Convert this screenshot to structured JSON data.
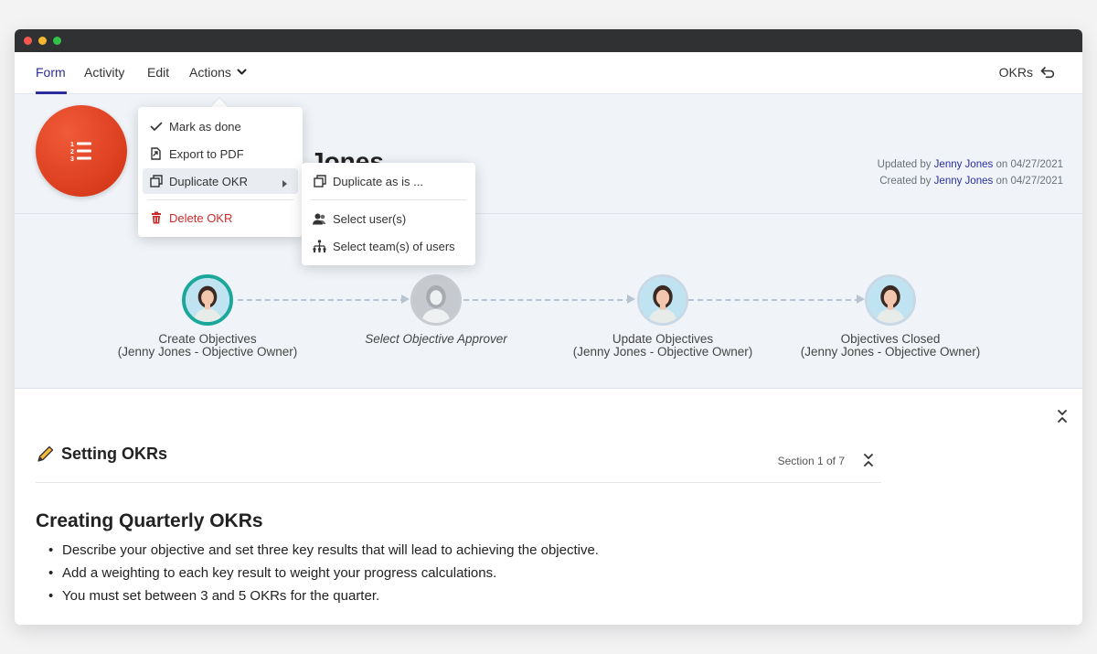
{
  "nav": {
    "tabs": [
      {
        "label": "Form",
        "active": true
      },
      {
        "label": "Activity"
      },
      {
        "label": "Edit"
      },
      {
        "label": "Actions"
      }
    ],
    "right_link": "OKRs",
    "accent_color": "#2a2d9c"
  },
  "header": {
    "title_visible_fragment": "Jones",
    "updated": {
      "prefix": "Updated by",
      "user": "Jenny Jones",
      "on": "on 04/27/2021"
    },
    "created": {
      "prefix": "Created by",
      "user": "Jenny Jones",
      "on": "on 04/27/2021"
    },
    "icon": "list-ordered-icon",
    "icon_color": "#d83b1b"
  },
  "actions_menu": {
    "items": [
      {
        "label": "Mark as done",
        "icon": "check-icon"
      },
      {
        "label": "Export to PDF",
        "icon": "export-pdf-icon"
      },
      {
        "label": "Duplicate OKR",
        "icon": "duplicate-icon",
        "highlighted": true,
        "has_submenu": true
      },
      {
        "label": "Delete OKR",
        "icon": "trash-icon",
        "danger": true
      }
    ],
    "submenu": [
      {
        "label": "Duplicate as is ...",
        "icon": "duplicate-icon"
      },
      {
        "label": "Select user(s)",
        "icon": "users-icon"
      },
      {
        "label": "Select team(s) of users",
        "icon": "team-hierarchy-icon"
      }
    ]
  },
  "workflow": {
    "steps": [
      {
        "name": "Create Objectives",
        "owner": "(Jenny Jones - Objective Owner)",
        "state": "current"
      },
      {
        "name": "Select Objective Approver",
        "owner": "",
        "state": "unassigned"
      },
      {
        "name": "Update Objectives",
        "owner": "(Jenny Jones - Objective Owner)",
        "state": "pending"
      },
      {
        "name": "Objectives Closed",
        "owner": "(Jenny Jones - Objective Owner)",
        "state": "pending"
      }
    ],
    "current_color": "#1aa89a"
  },
  "section": {
    "title": "Setting OKRs",
    "counter": "Section 1 of 7",
    "heading": "Creating Quarterly OKRs",
    "bullets": [
      "Describe your objective and set three key results that will lead to achieving the objective.",
      "Add a weighting to each key result to weight your progress calculations.",
      "You must set between 3 and 5 OKRs for the quarter."
    ]
  }
}
